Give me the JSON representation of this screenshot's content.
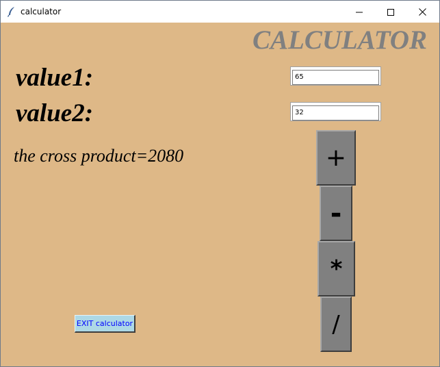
{
  "window": {
    "title": "calculator",
    "icon": "feather-icon",
    "controls": [
      "minimize-icon",
      "maximize-icon",
      "close-icon"
    ]
  },
  "heading": "CALCULATOR",
  "inputs": {
    "value1_label": "value1:",
    "value1": "65",
    "value2_label": "value2:",
    "value2": "32"
  },
  "result_text": "the cross product=2080",
  "operations": {
    "add": "+",
    "subtract": "-",
    "multiply": "*",
    "divide": "/"
  },
  "exit_label": "EXIT calculator",
  "colors": {
    "background": "#deb887",
    "heading": "#808080",
    "operation_button": "#808080",
    "exit_button": "#add8e6",
    "exit_text": "#0000ff"
  }
}
